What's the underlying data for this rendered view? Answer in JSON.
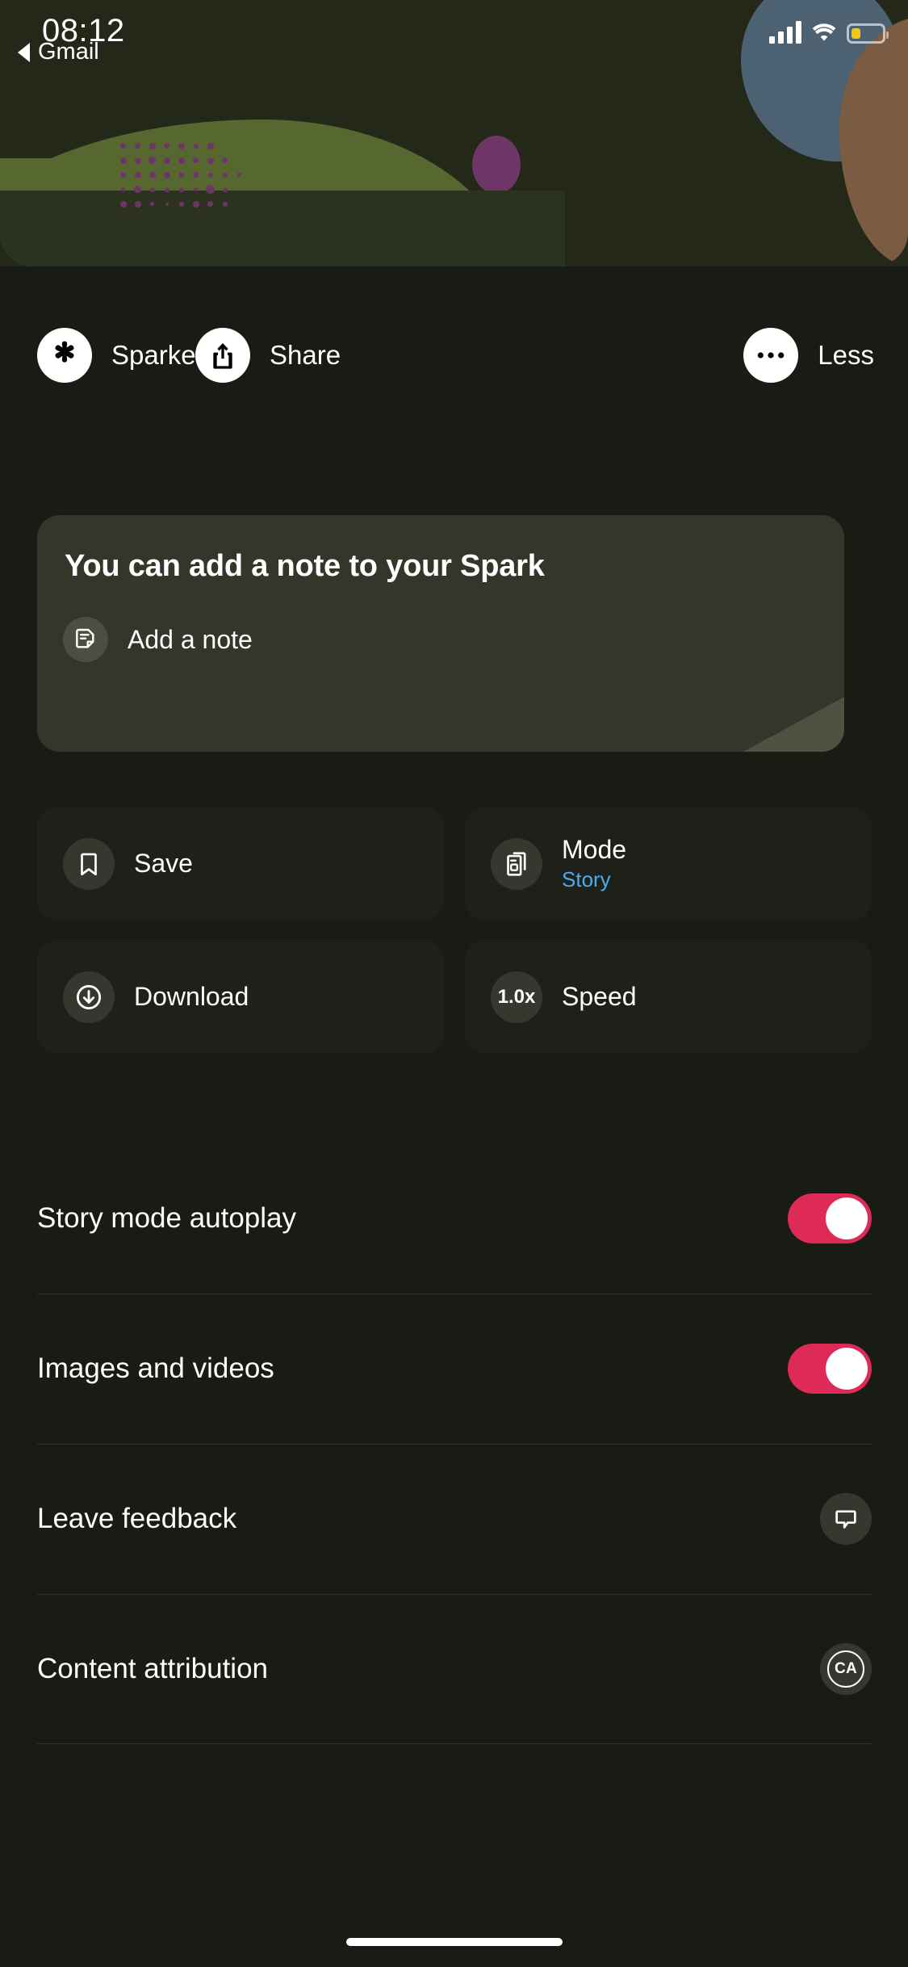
{
  "status_bar": {
    "time": "08:12",
    "back_label": "Gmail",
    "icons": {
      "back": "back-triangle-icon",
      "signal": "cellular-signal-icon",
      "wifi": "wifi-icon",
      "battery": "battery-low-icon"
    },
    "battery_color": "#f5c518"
  },
  "hero": {
    "name": "article-illustration",
    "colors": {
      "background": "#232818",
      "green": "#56682f",
      "purple": "#6e3567",
      "blue": "#4c6172",
      "brown": "#7b5c42",
      "dark_green": "#2c3220"
    }
  },
  "actions": [
    {
      "label": "Sparked",
      "icon": "spark-icon"
    },
    {
      "label": "Share",
      "icon": "share-icon"
    },
    {
      "label": "Less",
      "icon": "more-dots-icon"
    }
  ],
  "note_card": {
    "title": "You can add a note to your Spark",
    "action_label": "Add a note",
    "action_icon": "note-icon"
  },
  "tiles": [
    {
      "label": "Save",
      "sub": "",
      "icon": "bookmark-icon"
    },
    {
      "label": "Mode",
      "sub": "Story",
      "icon": "pages-icon"
    },
    {
      "label": "Download",
      "sub": "",
      "icon": "download-icon"
    },
    {
      "label": "Speed",
      "sub": "",
      "icon": "speed-badge",
      "badge": "1.0x"
    }
  ],
  "settings": [
    {
      "label": "Story mode autoplay",
      "control": "toggle",
      "value": "on"
    },
    {
      "label": "Images and videos",
      "control": "toggle",
      "value": "on"
    },
    {
      "label": "Leave feedback",
      "control": "icon",
      "icon": "comment-icon"
    },
    {
      "label": "Content attribution",
      "control": "icon",
      "icon": "content-attribution-icon",
      "badge": "CA"
    }
  ],
  "colors": {
    "accent_toggle": "#dd2a56",
    "link_blue": "#4daaf0",
    "page_background": "#181c14",
    "tile_background": "#1d211a",
    "card_background": "#333629"
  }
}
